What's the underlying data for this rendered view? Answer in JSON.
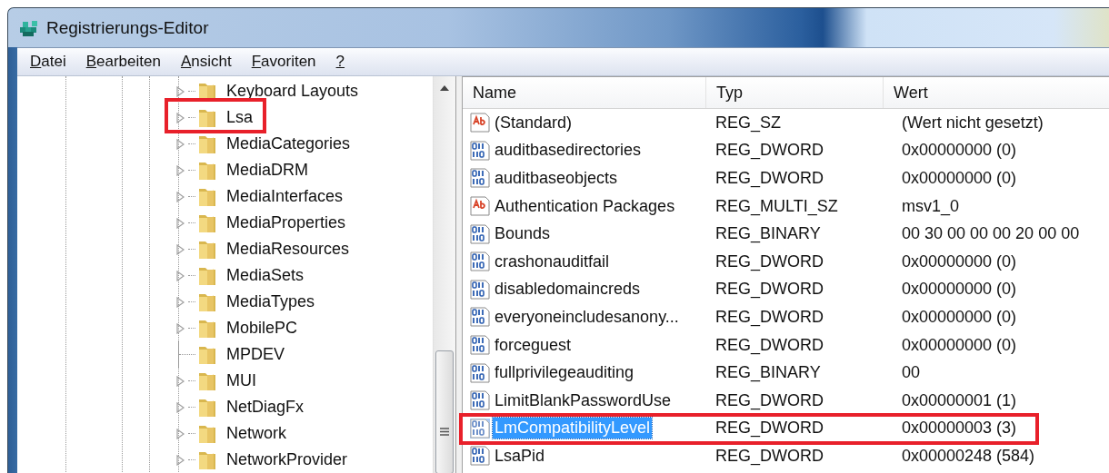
{
  "window": {
    "title": "Registrierungs-Editor"
  },
  "menu": [
    {
      "label": "Datei"
    },
    {
      "label": "Bearbeiten"
    },
    {
      "label": "Ansicht"
    },
    {
      "label": "Favoriten"
    },
    {
      "label": "?"
    }
  ],
  "tree": {
    "items": [
      {
        "label": "Keyboard Layouts",
        "expandable": true,
        "highlighted": false
      },
      {
        "label": "Lsa",
        "expandable": true,
        "highlighted": true
      },
      {
        "label": "MediaCategories",
        "expandable": true,
        "highlighted": false
      },
      {
        "label": "MediaDRM",
        "expandable": true,
        "highlighted": false
      },
      {
        "label": "MediaInterfaces",
        "expandable": true,
        "highlighted": false
      },
      {
        "label": "MediaProperties",
        "expandable": true,
        "highlighted": false
      },
      {
        "label": "MediaResources",
        "expandable": true,
        "highlighted": false
      },
      {
        "label": "MediaSets",
        "expandable": true,
        "highlighted": false
      },
      {
        "label": "MediaTypes",
        "expandable": true,
        "highlighted": false
      },
      {
        "label": "MobilePC",
        "expandable": true,
        "highlighted": false
      },
      {
        "label": "MPDEV",
        "expandable": false,
        "highlighted": false
      },
      {
        "label": "MUI",
        "expandable": true,
        "highlighted": false
      },
      {
        "label": "NetDiagFx",
        "expandable": true,
        "highlighted": false
      },
      {
        "label": "Network",
        "expandable": true,
        "highlighted": false
      },
      {
        "label": "NetworkProvider",
        "expandable": true,
        "highlighted": false
      }
    ]
  },
  "table": {
    "columns": [
      "Name",
      "Typ",
      "Wert"
    ],
    "rows": [
      {
        "kind": "string",
        "name": "(Standard)",
        "type": "REG_SZ",
        "value": "(Wert nicht gesetzt)",
        "selected": false,
        "highlighted": false
      },
      {
        "kind": "binary",
        "name": "auditbasedirectories",
        "type": "REG_DWORD",
        "value": "0x00000000 (0)",
        "selected": false,
        "highlighted": false
      },
      {
        "kind": "binary",
        "name": "auditbaseobjects",
        "type": "REG_DWORD",
        "value": "0x00000000 (0)",
        "selected": false,
        "highlighted": false
      },
      {
        "kind": "string",
        "name": "Authentication Packages",
        "type": "REG_MULTI_SZ",
        "value": "msv1_0",
        "selected": false,
        "highlighted": false
      },
      {
        "kind": "binary",
        "name": "Bounds",
        "type": "REG_BINARY",
        "value": "00 30 00 00 00 20 00 00",
        "selected": false,
        "highlighted": false
      },
      {
        "kind": "binary",
        "name": "crashonauditfail",
        "type": "REG_DWORD",
        "value": "0x00000000 (0)",
        "selected": false,
        "highlighted": false
      },
      {
        "kind": "binary",
        "name": "disabledomaincreds",
        "type": "REG_DWORD",
        "value": "0x00000000 (0)",
        "selected": false,
        "highlighted": false
      },
      {
        "kind": "binary",
        "name": "everyoneincludesanony...",
        "type": "REG_DWORD",
        "value": "0x00000000 (0)",
        "selected": false,
        "highlighted": false
      },
      {
        "kind": "binary",
        "name": "forceguest",
        "type": "REG_DWORD",
        "value": "0x00000000 (0)",
        "selected": false,
        "highlighted": false
      },
      {
        "kind": "binary",
        "name": "fullprivilegeauditing",
        "type": "REG_BINARY",
        "value": "00",
        "selected": false,
        "highlighted": false
      },
      {
        "kind": "binary",
        "name": "LimitBlankPasswordUse",
        "type": "REG_DWORD",
        "value": "0x00000001 (1)",
        "selected": false,
        "highlighted": false
      },
      {
        "kind": "binary",
        "name": "LmCompatibilityLevel",
        "type": "REG_DWORD",
        "value": "0x00000003 (3)",
        "selected": true,
        "highlighted": true
      },
      {
        "kind": "binary",
        "name": "LsaPid",
        "type": "REG_DWORD",
        "value": "0x00000248 (584)",
        "selected": false,
        "highlighted": false
      }
    ]
  }
}
